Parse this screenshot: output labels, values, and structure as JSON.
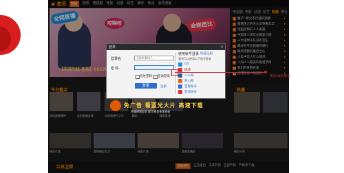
{
  "nav": {
    "logo": "◉ 首页",
    "items": [
      "直播",
      "视频",
      "电视剧",
      "电影",
      "动漫",
      "综艺",
      "娱乐",
      "热点",
      "会员观看"
    ]
  },
  "banner": {
    "tag1": "全网首播",
    "tag2": "咬啊咬",
    "tag3": "金刚芭比",
    "ad": "【非诚勿扰·新版】0517晚"
  },
  "side": {
    "tabs": [
      "电视剧",
      "电影",
      "动漫",
      "综艺",
      "热播",
      "排行"
    ],
    "items": [
      "瘦子! 继父不行强奸施暴",
      "猪猪侠之开天火灵界嘉年华",
      "全国首揭开人人美丽",
      "中国第八周年长期复习课",
      "十大强悍乐队没有音乐",
      "最好的专业新娘的婚礼",
      "最新完整的最近之乐",
      "人类中年人什么情况",
      "人间人人最美的电视节目",
      "我们的青春有爱",
      "笑死所有人的游戏"
    ]
  },
  "section": {
    "today": "今日重点",
    "hot": "热播",
    "bottom_title": "江苏卫视"
  },
  "row1_captions": [
    "实拍超级模特",
    "实拍超美女星",
    "实拍超旅行之乐",
    "精彩",
    "精彩推荐"
  ],
  "row2_captions": [
    "精彩片段",
    "我的精彩生活",
    "精彩片段",
    "我最爱精彩",
    "精彩分享"
  ],
  "bottom": {
    "tabs": [
      "直播预告",
      "正在播出",
      "未来节目",
      "全部节目",
      "节目单下载"
    ]
  },
  "promo": {
    "title": "免广告 看蓝光大片 高速下载",
    "sub": "开通视频会员 即可享受多项特权"
  },
  "dialog": {
    "title": "登录",
    "close": "×",
    "username_label": "登录名",
    "username_value": "138008817...",
    "password_label": "密 码",
    "password_value": "",
    "remember": "记住密码",
    "auto_login": "自动登录",
    "login_button": "登录",
    "register": "注册",
    "other_title": "使用帐号登录",
    "register_quick": "快速注册",
    "other_sub": "我也可以使用以下账号登录",
    "providers": [
      "QQ",
      "微博",
      "人人网",
      "开心网",
      "百度帐号",
      "新浪帐号"
    ]
  },
  "callout": {
    "text": "用QQ帐号登录"
  }
}
